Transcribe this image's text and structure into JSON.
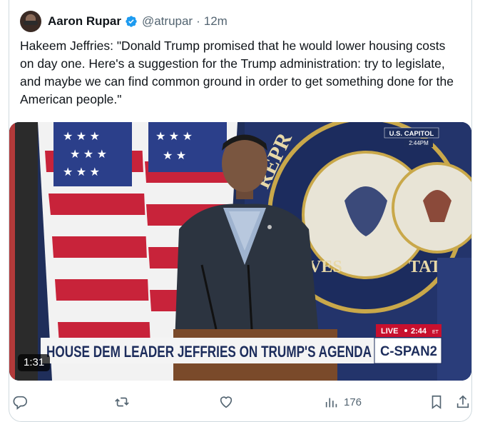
{
  "author": {
    "name": "Aaron Rupar",
    "handle": "@atrupar",
    "separator": "·",
    "time": "12m",
    "verified_color": "#1d9bf0"
  },
  "tweet": {
    "text": "Hakeem Jeffries: \"Donald Trump promised that he would lower housing costs on day one. Here's a suggestion for the Trump administration: try to legislate, and maybe we can find common ground in order to get something done for the American people.\""
  },
  "video": {
    "duration": "1:31",
    "location_tag": "U.S. CAPITOL",
    "location_time": "2:44PM",
    "live_label": "LIVE",
    "live_time": "2:44",
    "live_suffix": "ET",
    "headline": "HOUSE DEM LEADER JEFFRIES ON TRUMP'S AGENDA",
    "network": "C-SPAN2",
    "seal_text": "REPRESENTATIVES"
  },
  "actions": {
    "reply_icon": "reply-icon",
    "retweet_icon": "retweet-icon",
    "like_icon": "heart-icon",
    "views_icon": "views-icon",
    "views_count": "176",
    "bookmark_icon": "bookmark-icon",
    "share_icon": "share-icon"
  }
}
